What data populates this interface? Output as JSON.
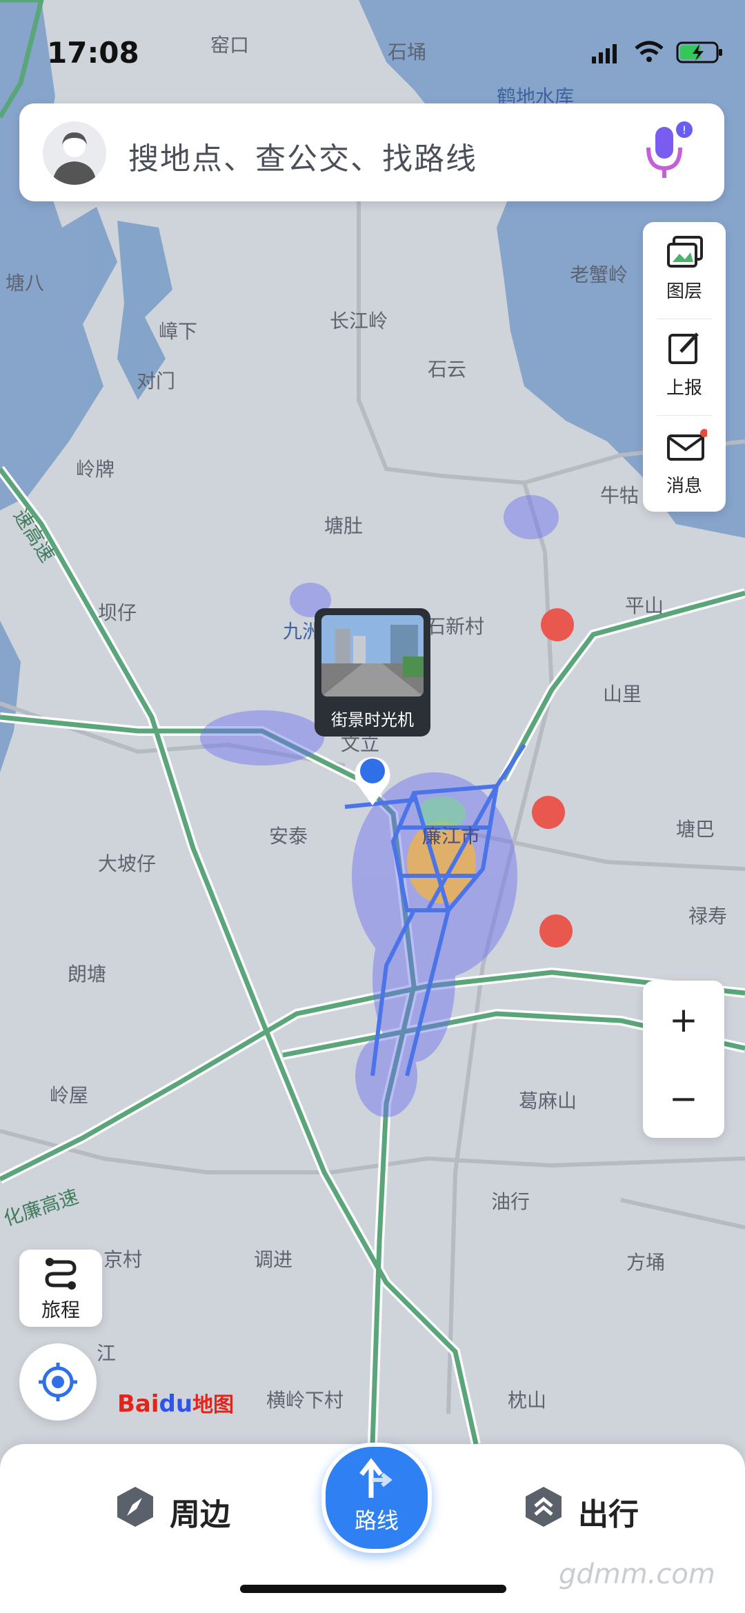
{
  "status": {
    "time": "17:08"
  },
  "search": {
    "placeholder": "搜地点、查公交、找路线"
  },
  "side_panel": {
    "layers_label": "图层",
    "report_label": "上报",
    "messages_label": "消息"
  },
  "zoom": {
    "in": "+",
    "out": "−"
  },
  "trip_label": "旅程",
  "logo": {
    "bai": "Bai",
    "du": "du",
    "map": "地图"
  },
  "street_view": {
    "label": "街景时光机"
  },
  "map_labels": {
    "yaokou": "窑口",
    "shiyong": "石埇",
    "heti": "鹤地水库",
    "tangba": "塘八",
    "laoxieling": "老蟹岭",
    "zhangxia": "嶂下",
    "changjiangling": "长江岭",
    "shiyun": "石云",
    "duimen": "对门",
    "lingpai": "岭牌",
    "tangdu": "塘肚",
    "niute": "牛牯",
    "bazai": "坝仔",
    "jiuzhoujiang": "九洲江",
    "shixincun": "石新村",
    "pingshan": "平山",
    "shanli": "山里",
    "wenli": "文立",
    "antai": "安泰",
    "lianjiang": "廉江市",
    "dapozai": "大坡仔",
    "tangba2": "塘巴",
    "lushou": "禄寿",
    "langtang": "朗塘",
    "lingwu": "岭屋",
    "gemashan": "葛麻山",
    "youxing": "油行",
    "fangyong": "方埇",
    "jingcun": "京村",
    "tiaojin": "调进",
    "jiang": "江",
    "henglingxiacun": "横岭下村",
    "zhenshan": "枕山",
    "hualian": "化廉高速",
    "expressway_left": "速高速"
  },
  "bottom_nav": {
    "nearby": "周边",
    "route": "路线",
    "travel": "出行"
  },
  "watermark": "gdmm.com",
  "colors": {
    "map_bg": "#cfd3da",
    "water": "#7e9fc9",
    "expressway": "#5aa57a",
    "traffic_heat": "#6a6ff0",
    "accent": "#2f80f2"
  }
}
